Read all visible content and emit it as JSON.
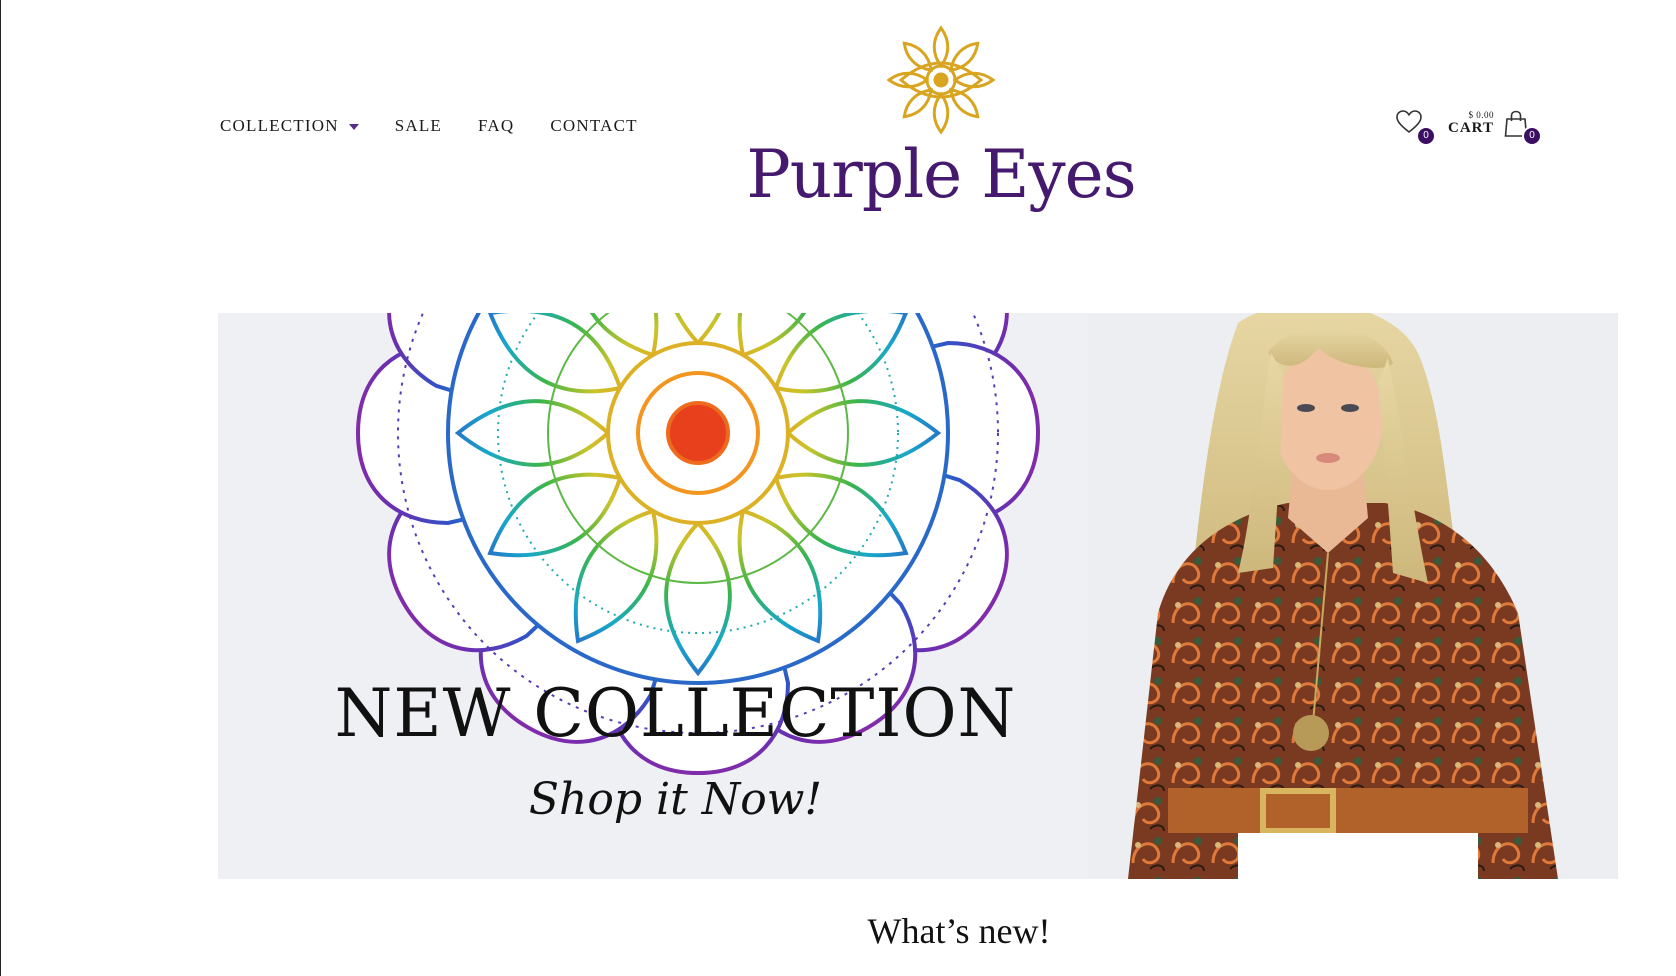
{
  "nav": {
    "items": [
      {
        "label": "COLLECTION",
        "has_dropdown": true
      },
      {
        "label": "SALE",
        "has_dropdown": false
      },
      {
        "label": "FAQ",
        "has_dropdown": false
      },
      {
        "label": "CONTACT",
        "has_dropdown": false
      }
    ]
  },
  "brand": {
    "name": "Purple Eyes",
    "logo_icon": "mandala-eye-icon",
    "name_color": "#44196e",
    "icon_color": "#d9a521"
  },
  "header_right": {
    "wishlist_icon": "heart-icon",
    "wishlist_count": "0",
    "cart_price": "$ 0.00",
    "cart_label": "CART",
    "cart_icon": "shopping-bag-icon",
    "cart_count": "0",
    "badge_color": "#3b0f63"
  },
  "hero": {
    "headline": "NEW COLLECTION",
    "subline": "Shop it Now!",
    "background": "#eef0f3",
    "decor_icon": "rainbow-mandala-icon",
    "photo_alt": "mannequin-paisley-blouse-image"
  },
  "section": {
    "title": "What’s new!"
  }
}
